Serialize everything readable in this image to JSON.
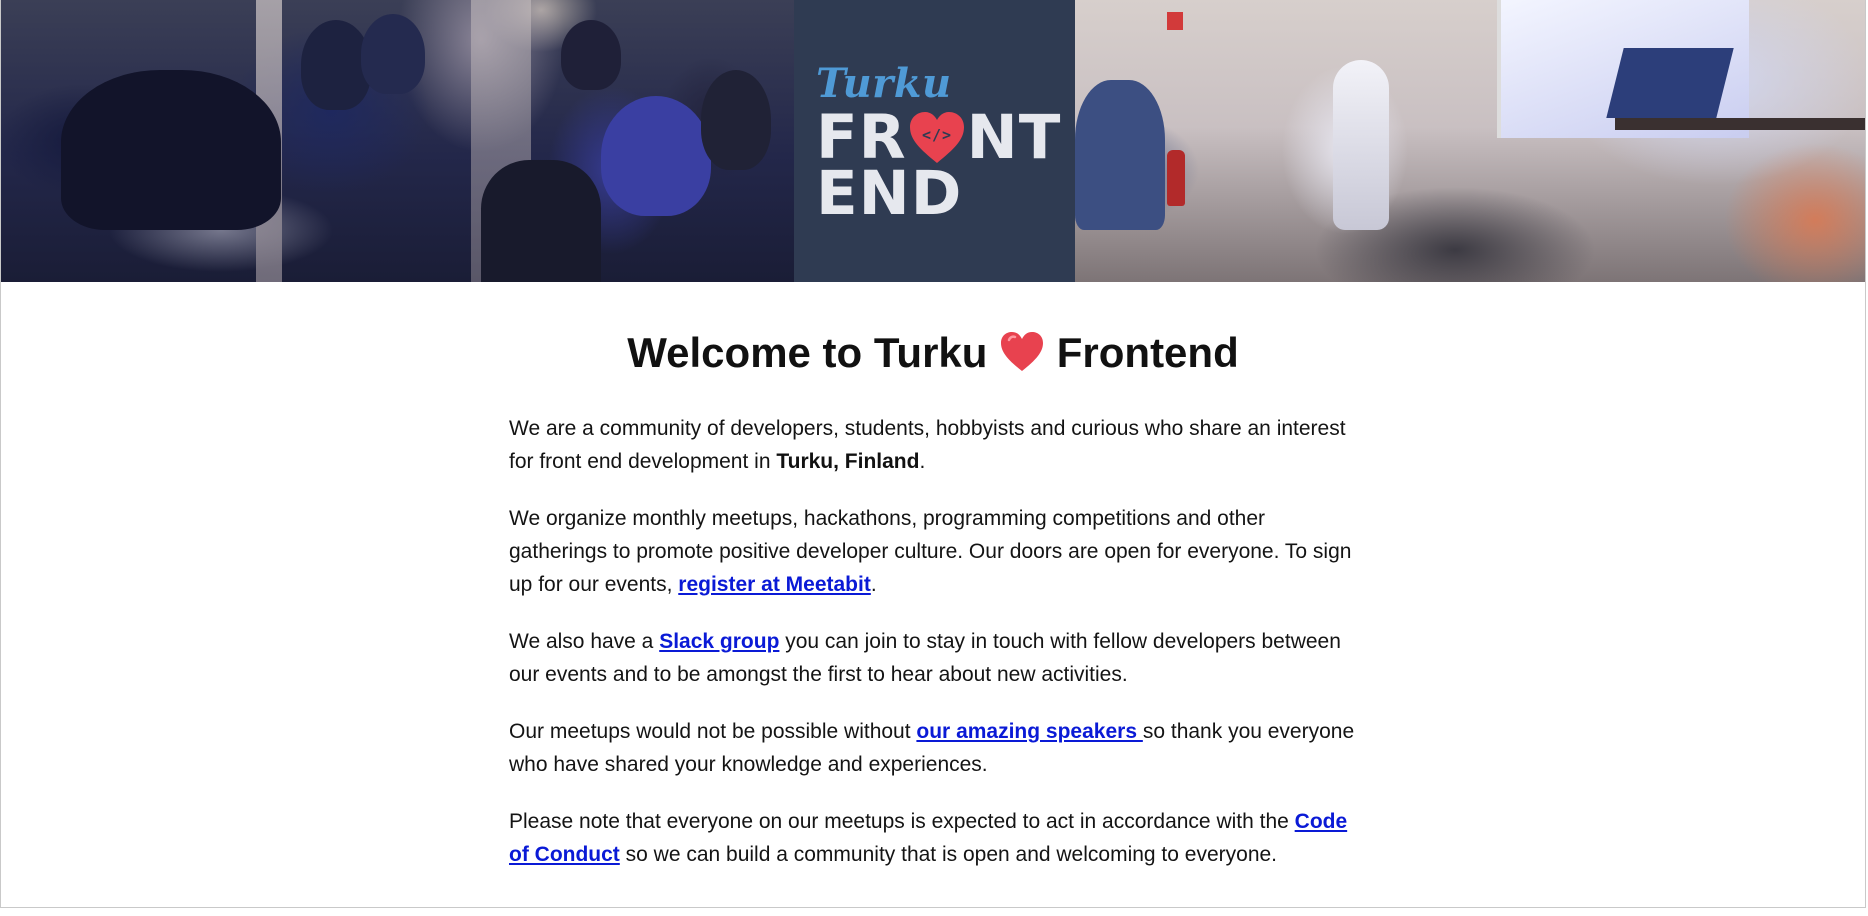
{
  "logo": {
    "script": "Turku",
    "line1_a": "FR",
    "line1_b": "NT",
    "line2": "END",
    "heart_code": "</>"
  },
  "heading": {
    "before": "Welcome to Turku ",
    "after": " Frontend"
  },
  "paragraphs": {
    "p1": {
      "text": "We are a community of developers, students, hobbyists and curious who share an interest for front end development in ",
      "strong": "Turku, Finland",
      "end": "."
    },
    "p2": {
      "text": "We organize monthly meetups, hackathons, programming competitions and other gatherings to promote positive developer culture. Our doors are open for everyone. To sign up for our events, ",
      "link": "register at Meetabit",
      "end": "."
    },
    "p3": {
      "text": "We also have a ",
      "link": "Slack group",
      "end": " you can join to stay in touch with fellow developers between our events and to be amongst the first to hear about new activities."
    },
    "p4": {
      "text": "Our meetups would not be possible without ",
      "link": "our amazing speakers ",
      "end": "so thank you everyone who have shared your knowledge and experiences."
    },
    "p5": {
      "text": "Please note that everyone on our meetups is expected to act in accordance with the ",
      "link": "Code of Conduct",
      "end": " so we can build a community that is open and welcoming to everyone."
    }
  },
  "colors": {
    "link": "#0a1ad6",
    "logo_panel": "#2f3b52",
    "logo_script": "#4f9ad6",
    "heart": "#e8424f"
  }
}
